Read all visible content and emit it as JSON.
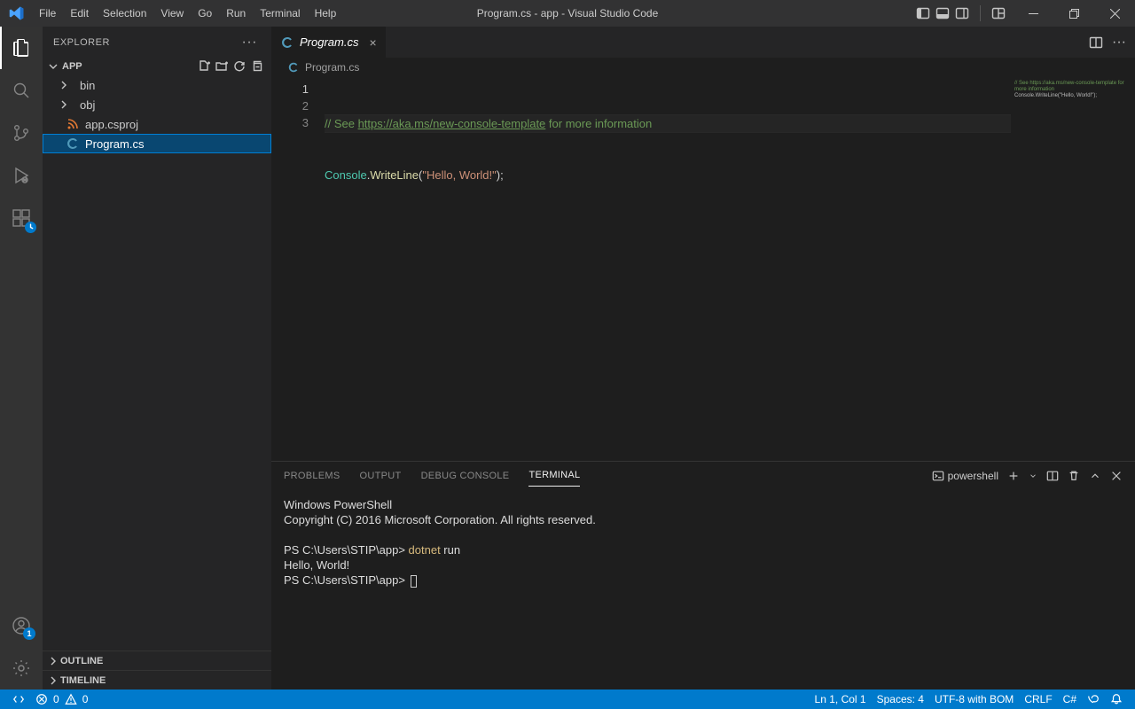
{
  "window": {
    "title": "Program.cs - app - Visual Studio Code"
  },
  "menu": {
    "items": [
      "File",
      "Edit",
      "Selection",
      "View",
      "Go",
      "Run",
      "Terminal",
      "Help"
    ]
  },
  "activitybar": {
    "account_badge": "1"
  },
  "explorer": {
    "title": "EXPLORER",
    "project": "APP",
    "folders": [
      {
        "name": "bin"
      },
      {
        "name": "obj"
      }
    ],
    "files": [
      {
        "name": "app.csproj",
        "icon": "rss"
      },
      {
        "name": "Program.cs",
        "icon": "cs",
        "selected": true
      }
    ],
    "sections": {
      "outline": "OUTLINE",
      "timeline": "TIMELINE"
    }
  },
  "editor": {
    "tab": {
      "filename": "Program.cs"
    },
    "breadcrumb": {
      "filename": "Program.cs"
    },
    "gutter": [
      "1",
      "2",
      "3"
    ],
    "line1": {
      "prefix": "// See ",
      "url": "https://aka.ms/new-console-template",
      "suffix": " for more information"
    },
    "line2": {
      "type": "Console",
      "dot": ".",
      "member": "WriteLine",
      "open": "(",
      "string": "\"Hello, World!\"",
      "close": ");"
    }
  },
  "panel": {
    "tabs": {
      "problems": "PROBLEMS",
      "output": "OUTPUT",
      "debug": "DEBUG CONSOLE",
      "terminal": "TERMINAL"
    },
    "shell_label": "powershell",
    "terminal": {
      "l1": "Windows PowerShell",
      "l2": "Copyright (C) 2016 Microsoft Corporation. All rights reserved.",
      "prompt1_pre": "PS C:\\Users\\STIP\\app> ",
      "cmd_yellow": "dotnet",
      "cmd_rest": " run",
      "out1": "Hello, World!",
      "prompt2": "PS C:\\Users\\STIP\\app> "
    }
  },
  "status": {
    "errors": "0",
    "warnings": "0",
    "ln_col": "Ln 1, Col 1",
    "spaces": "Spaces: 4",
    "encoding": "UTF-8 with BOM",
    "eol": "CRLF",
    "lang": "C#"
  }
}
